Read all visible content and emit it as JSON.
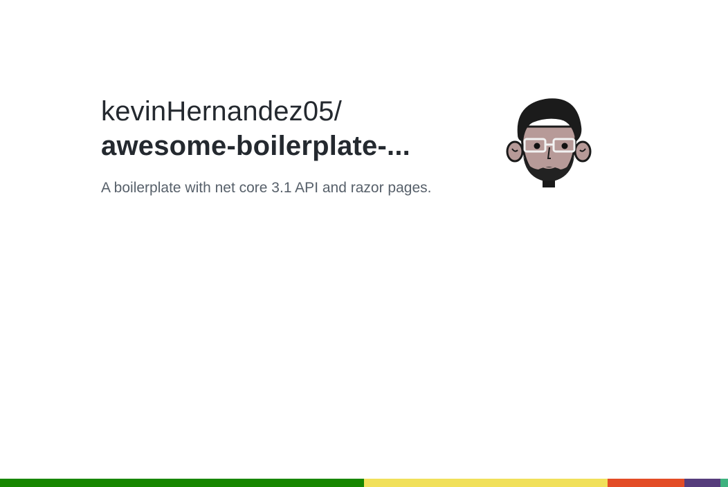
{
  "card": {
    "owner": "kevinHernandez05/",
    "repo": "awesome-boilerplate-...",
    "description": "A boilerplate with net core 3.1 API and razor pages."
  },
  "avatar": {
    "icon": "avatar-cartoon-face"
  },
  "languages": [
    {
      "color": "#178600",
      "share": 0.5
    },
    {
      "color": "#f1e05a",
      "share": 0.335
    },
    {
      "color": "#e34c26",
      "share": 0.105
    },
    {
      "color": "#563d7c",
      "share": 0.05
    },
    {
      "color": "#3fb27f",
      "share": 0.01
    }
  ]
}
